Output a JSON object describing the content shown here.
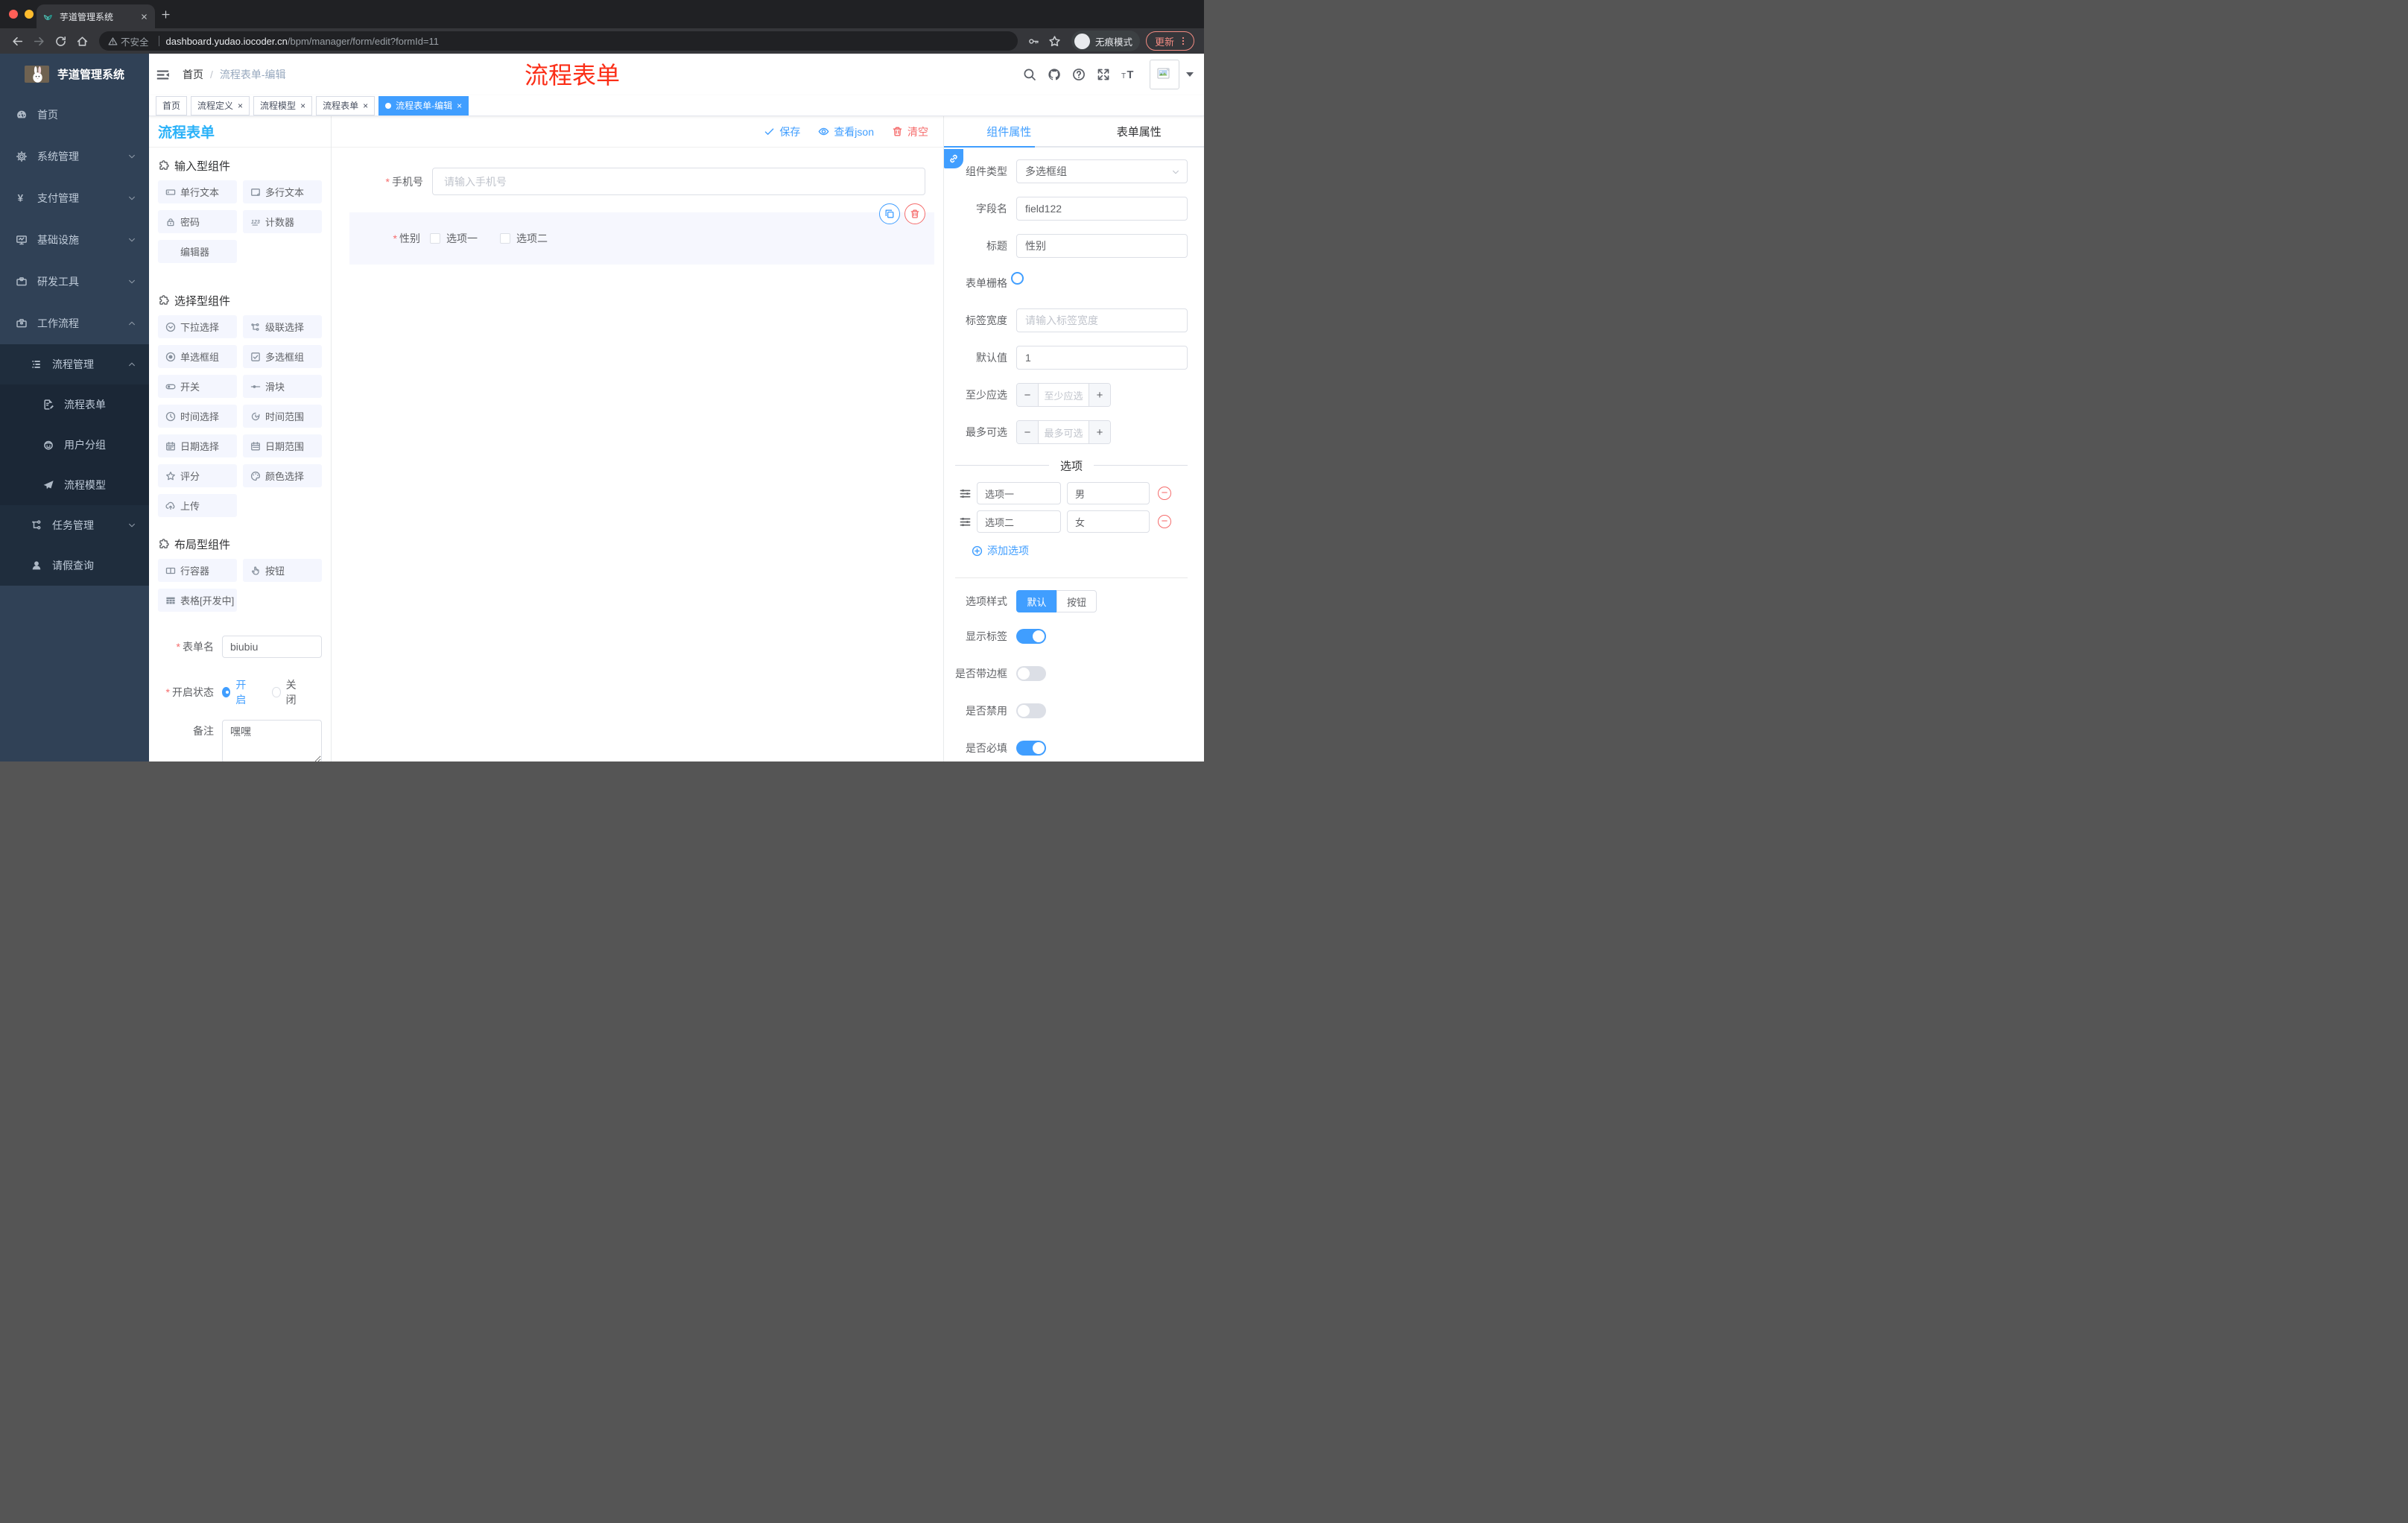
{
  "browser": {
    "tab_title": "芋道管理系统",
    "security_label": "不安全",
    "url_domain": "dashboard.yudao.iocoder.cn",
    "url_path": "/bpm/manager/form/edit?formId=11",
    "incognito_label": "无痕模式",
    "update_label": "更新"
  },
  "annotation": "流程表单",
  "sidebar": {
    "brand": "芋道管理系统",
    "menu": [
      {
        "label": "首页",
        "icon": "dashboard",
        "level": 1
      },
      {
        "label": "系统管理",
        "icon": "gear",
        "level": 1,
        "arrow": "down"
      },
      {
        "label": "支付管理",
        "icon": "yen",
        "level": 1,
        "arrow": "down"
      },
      {
        "label": "基础设施",
        "icon": "monitor",
        "level": 1,
        "arrow": "down"
      },
      {
        "label": "研发工具",
        "icon": "toolbox",
        "level": 1,
        "arrow": "down"
      },
      {
        "label": "工作流程",
        "icon": "briefcase",
        "level": 1,
        "arrow": "up"
      },
      {
        "label": "流程管理",
        "icon": "flowlist",
        "level": 2,
        "arrow": "up"
      },
      {
        "label": "流程表单",
        "icon": "docedit",
        "level": 3
      },
      {
        "label": "用户分组",
        "icon": "robot",
        "level": 3
      },
      {
        "label": "流程模型",
        "icon": "plane",
        "level": 3
      },
      {
        "label": "任务管理",
        "icon": "tree",
        "level": 2,
        "arrow": "down"
      },
      {
        "label": "请假查询",
        "icon": "user",
        "level": 2
      }
    ]
  },
  "navbar": {
    "breadcrumb": [
      "首页",
      "流程表单-编辑"
    ]
  },
  "tags": [
    {
      "label": "首页",
      "closable": false,
      "active": false
    },
    {
      "label": "流程定义",
      "closable": true,
      "active": false
    },
    {
      "label": "流程模型",
      "closable": true,
      "active": false
    },
    {
      "label": "流程表单",
      "closable": true,
      "active": false
    },
    {
      "label": "流程表单-编辑",
      "closable": true,
      "active": true
    }
  ],
  "palette": {
    "title": "流程表单",
    "sections": [
      {
        "title": "输入型组件",
        "items": [
          {
            "label": "单行文本",
            "icon": "input"
          },
          {
            "label": "多行文本",
            "icon": "textarea"
          },
          {
            "label": "密码",
            "icon": "lock"
          },
          {
            "label": "计数器",
            "icon": "counter"
          },
          {
            "label": "编辑器",
            "icon": ""
          }
        ]
      },
      {
        "title": "选择型组件",
        "items": [
          {
            "label": "下拉选择",
            "icon": "select"
          },
          {
            "label": "级联选择",
            "icon": "cascader"
          },
          {
            "label": "单选框组",
            "icon": "radio"
          },
          {
            "label": "多选框组",
            "icon": "checkbox"
          },
          {
            "label": "开关",
            "icon": "switch"
          },
          {
            "label": "滑块",
            "icon": "slider"
          },
          {
            "label": "时间选择",
            "icon": "time"
          },
          {
            "label": "时间范围",
            "icon": "timerange"
          },
          {
            "label": "日期选择",
            "icon": "date"
          },
          {
            "label": "日期范围",
            "icon": "daterange"
          },
          {
            "label": "评分",
            "icon": "star"
          },
          {
            "label": "颜色选择",
            "icon": "color"
          },
          {
            "label": "上传",
            "icon": "upload"
          }
        ]
      },
      {
        "title": "布局型组件",
        "items": [
          {
            "label": "行容器",
            "icon": "rowc"
          },
          {
            "label": "按钮",
            "icon": "pointer"
          },
          {
            "label": "表格[开发中]",
            "icon": "table"
          }
        ]
      }
    ],
    "meta": {
      "name_label": "表单名",
      "name_value": "biubiu",
      "status_label": "开启状态",
      "status_on": "开启",
      "status_off": "关闭",
      "remark_label": "备注",
      "remark_value": "嘿嘿"
    }
  },
  "canvas": {
    "save_label": "保存",
    "view_json_label": "查看json",
    "clear_label": "清空",
    "phone_label": "手机号",
    "phone_placeholder": "请输入手机号",
    "gender_label": "性别",
    "gender_options": [
      "选项一",
      "选项二"
    ]
  },
  "panel": {
    "tab_component": "组件属性",
    "tab_form": "表单属性",
    "rows": {
      "type_label": "组件类型",
      "type_value": "多选框组",
      "field_label": "字段名",
      "field_value": "field122",
      "title_label": "标题",
      "title_value": "性别",
      "grid_label": "表单栅格",
      "label_width_label": "标签宽度",
      "label_width_placeholder": "请输入标签宽度",
      "default_label": "默认值",
      "default_value": "1",
      "min_label": "至少应选",
      "min_placeholder": "至少应选",
      "max_label": "最多可选",
      "max_placeholder": "最多可选"
    },
    "options_divider": "选项",
    "options": [
      {
        "label": "选项一",
        "value": "男"
      },
      {
        "label": "选项二",
        "value": "女"
      }
    ],
    "add_option_label": "添加选项",
    "style_label": "选项样式",
    "style_options": [
      "默认",
      "按钮"
    ],
    "style_active": "默认",
    "toggles": [
      {
        "label": "显示标签",
        "on": true
      },
      {
        "label": "是否带边框",
        "on": false
      },
      {
        "label": "是否禁用",
        "on": false
      },
      {
        "label": "是否必填",
        "on": true
      }
    ]
  },
  "colors": {
    "primary": "#409eff",
    "danger": "#f56c6c",
    "title_blue": "#29b1f8",
    "annotation_red": "#fb2e17"
  }
}
